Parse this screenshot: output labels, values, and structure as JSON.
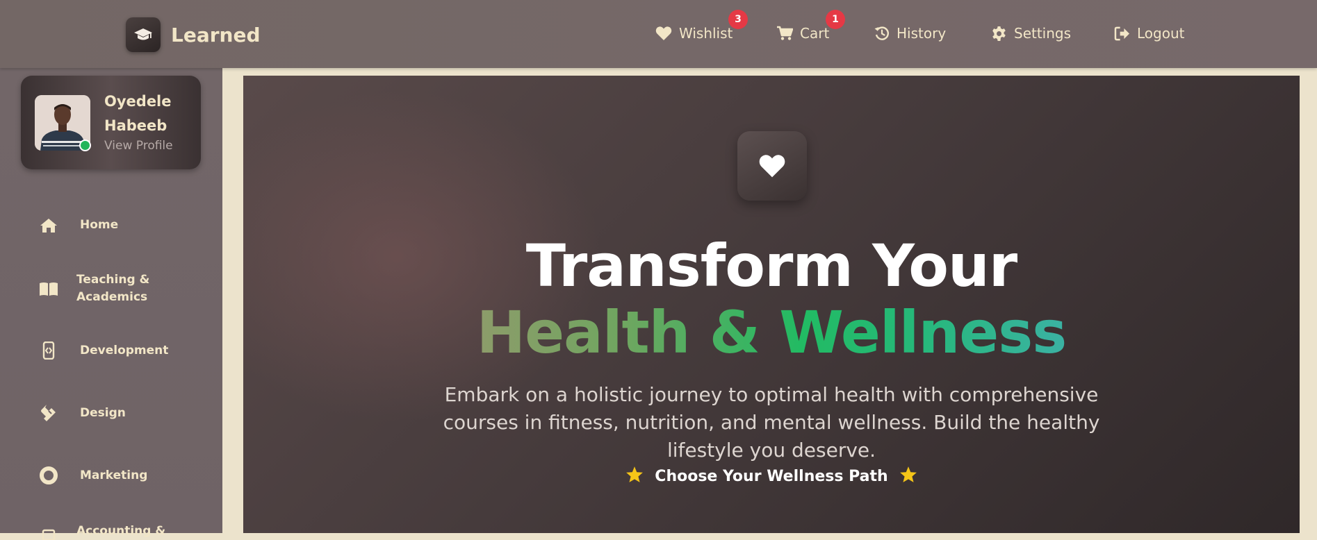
{
  "app": {
    "name": "Learned"
  },
  "nav": {
    "wishlist": {
      "label": "Wishlist",
      "count": "3"
    },
    "cart": {
      "label": "Cart",
      "count": "1"
    },
    "history": {
      "label": "History"
    },
    "settings": {
      "label": "Settings"
    },
    "logout": {
      "label": "Logout"
    }
  },
  "profile": {
    "first_name": "Oyedele",
    "last_name": "Habeeb",
    "link": "View Profile",
    "status": "online"
  },
  "sidebar": {
    "items": [
      {
        "label": "Home",
        "icon": "home-icon"
      },
      {
        "label": "Teaching & Academics",
        "icon": "book-icon"
      },
      {
        "label": "Development",
        "icon": "code-file-icon"
      },
      {
        "label": "Design",
        "icon": "design-icon"
      },
      {
        "label": "Marketing",
        "icon": "circle-icon"
      },
      {
        "label": "Accounting &",
        "icon": "calculator-icon"
      }
    ]
  },
  "hero": {
    "icon": "heart-icon",
    "title_line1": "Transform Your",
    "title_line2": "Health & Wellness",
    "subtitle": "Embark on a holistic journey to optimal health with comprehensive courses in fitness, nutrition, and mental wellness. Build the healthy lifestyle you deserve.",
    "cta": "Choose Your Wellness Path"
  },
  "colors": {
    "topbar": "#736765",
    "sidebar": "#726668",
    "accent_cream": "#f2e6c7",
    "badge": "#e53945",
    "online": "#22b55a",
    "star": "#f5c518",
    "gradient_start": "#8d9c6a",
    "gradient_mid": "#22bb63",
    "gradient_end": "#3bb2a3"
  }
}
